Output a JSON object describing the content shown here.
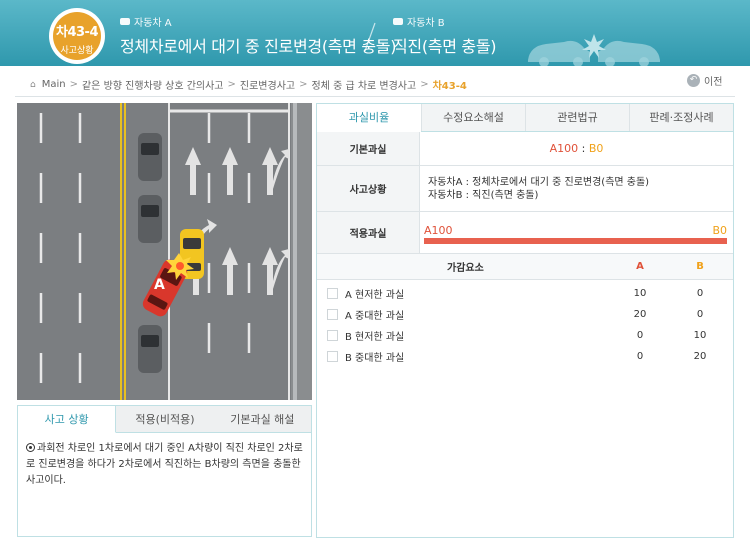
{
  "header": {
    "badge_code": "차43-4",
    "badge_sub": "사고상황",
    "car_a_label": "자동차 A",
    "car_a_title": "정체차로에서 대기 중 진로변경(측면 충돌)",
    "car_b_label": "자동차 B",
    "car_b_title": "직진(측면 충돌)"
  },
  "breadcrumb": [
    "Main",
    "같은 방향 진행차량 상호 간의사고",
    "진로변경사고",
    "정체 중 급 차로 변경사고",
    "차43-4"
  ],
  "prev_label": "이전",
  "scene": {
    "car_a_marker": "A"
  },
  "left_tabs": [
    "사고 상황",
    "적용(비적용)",
    "기본과실 해설"
  ],
  "description": "과회전 차로인 1차로에서 대기 중인 A차량이 직진 차로인 2차로로 진로변경을 하다가 2차로에서 직진하는 B차량의 측면을 충돌한 사고이다.",
  "right_tabs": [
    "과실비율",
    "수정요소해설",
    "관련법규",
    "판례·조정사례"
  ],
  "base": {
    "label": "기본과실",
    "a": "A100",
    "sep": " : ",
    "b": "B0"
  },
  "situation": {
    "label": "사고상황",
    "line1": "자동차A : 정체차로에서 대기 중 진로변경(측면 충돌)",
    "line2": "자동차B : 직진(측면 충돌)"
  },
  "applied": {
    "label": "적용과실",
    "a_label": "A100",
    "b_label": "B0",
    "a_share": 1.0
  },
  "adjust": {
    "head_name": "가감요소",
    "head_a": "A",
    "head_b": "B",
    "rows": [
      {
        "name": "A 현저한 과실",
        "a": "10",
        "b": "0"
      },
      {
        "name": "A 중대한 과실",
        "a": "20",
        "b": "0"
      },
      {
        "name": "B 현저한 과실",
        "a": "0",
        "b": "10"
      },
      {
        "name": "B 중대한 과실",
        "a": "0",
        "b": "20"
      }
    ]
  },
  "colors": {
    "accent": "#2f98ad",
    "a": "#e0523a",
    "b": "#f0a21b",
    "badge": "#e8a22b"
  }
}
